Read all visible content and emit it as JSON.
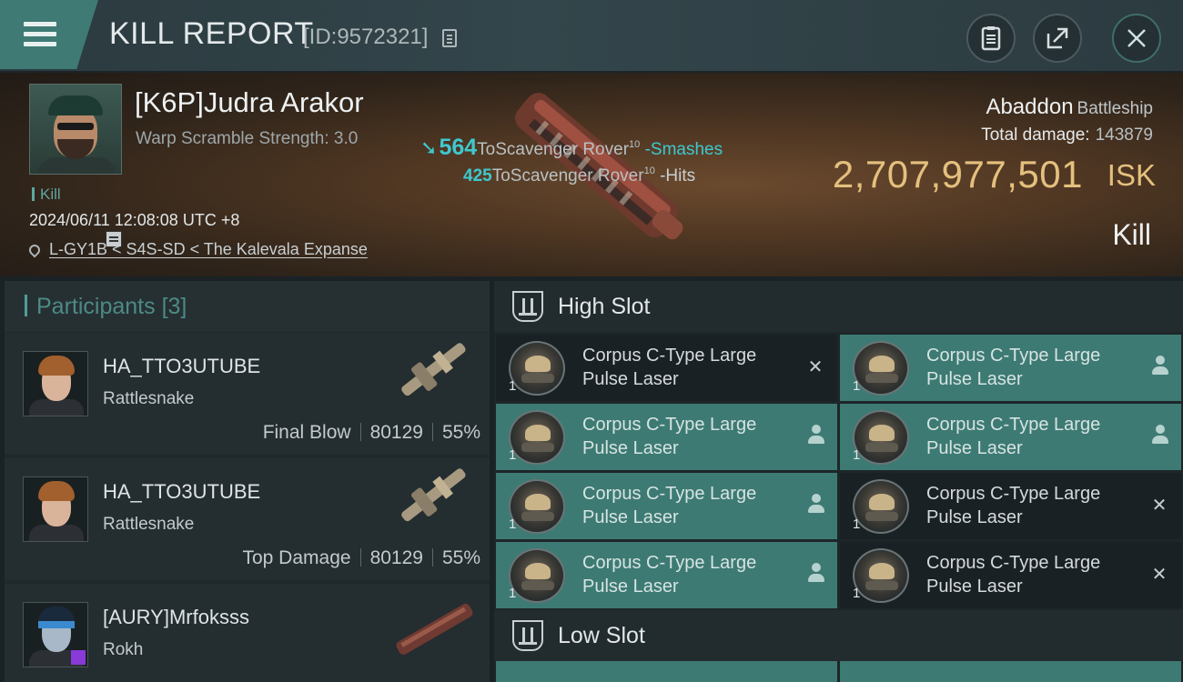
{
  "header": {
    "title": "KILL REPORT",
    "report_id": "[ID:9572321]",
    "icons": [
      "menu-icon",
      "copy-icon",
      "clipboard-icon",
      "share-icon",
      "close-icon"
    ]
  },
  "victim": {
    "name": "[K6P]Judra Arakor",
    "subtitle": "Warp Scramble Strength: 3.0",
    "tag": "Kill",
    "datetime": "2024/06/11 12:08:08 UTC +8",
    "location": "L-GY1B < S4S-SD < The Kalevala Expanse",
    "ship_name": "Abaddon",
    "ship_class": "Battleship",
    "total_damage_label": "Total damage:",
    "total_damage": "143879",
    "isk_value": "2,707,977,501",
    "isk_unit": "ISK",
    "result": "Kill"
  },
  "hits": [
    {
      "damage": "564",
      "target": "ToScavenger Rover",
      "level": "10",
      "verb": "-Smashes"
    },
    {
      "damage": "425",
      "target": "ToScavenger Rover",
      "level": "10",
      "verb": "-Hits"
    }
  ],
  "participants": {
    "title": "Participants",
    "count": "[3]",
    "rows": [
      {
        "name": "HA_TTO3UTUBE",
        "ship": "Rattlesnake",
        "label": "Final Blow",
        "damage": "80129",
        "percent": "55%"
      },
      {
        "name": "HA_TTO3UTUBE",
        "ship": "Rattlesnake",
        "label": "Top Damage",
        "damage": "80129",
        "percent": "55%"
      },
      {
        "name": "[AURY]Mrfoksss",
        "ship": "Rokh",
        "label": "",
        "damage": "",
        "percent": ""
      }
    ]
  },
  "slots": {
    "high_title": "High Slot",
    "low_title": "Low Slot",
    "high_modules": [
      {
        "line1": "Corpus C-Type Large",
        "line2": "Pulse Laser",
        "qty": "1",
        "state": "destroyed"
      },
      {
        "line1": "Corpus C-Type Large",
        "line2": "Pulse Laser",
        "qty": "1",
        "state": "dropped"
      },
      {
        "line1": "Corpus C-Type Large",
        "line2": "Pulse Laser",
        "qty": "1",
        "state": "dropped"
      },
      {
        "line1": "Corpus C-Type Large",
        "line2": "Pulse Laser",
        "qty": "1",
        "state": "dropped"
      },
      {
        "line1": "Corpus C-Type Large",
        "line2": "Pulse Laser",
        "qty": "1",
        "state": "dropped"
      },
      {
        "line1": "Corpus C-Type Large",
        "line2": "Pulse Laser",
        "qty": "1",
        "state": "destroyed"
      },
      {
        "line1": "Corpus C-Type Large",
        "line2": "Pulse Laser",
        "qty": "1",
        "state": "dropped"
      },
      {
        "line1": "Corpus C-Type Large",
        "line2": "Pulse Laser",
        "qty": "1",
        "state": "destroyed"
      }
    ]
  },
  "colors": {
    "accent_teal": "#3ec9cf",
    "isk_gold": "#e4c07e",
    "dropped_bg": "#3d7a73"
  }
}
